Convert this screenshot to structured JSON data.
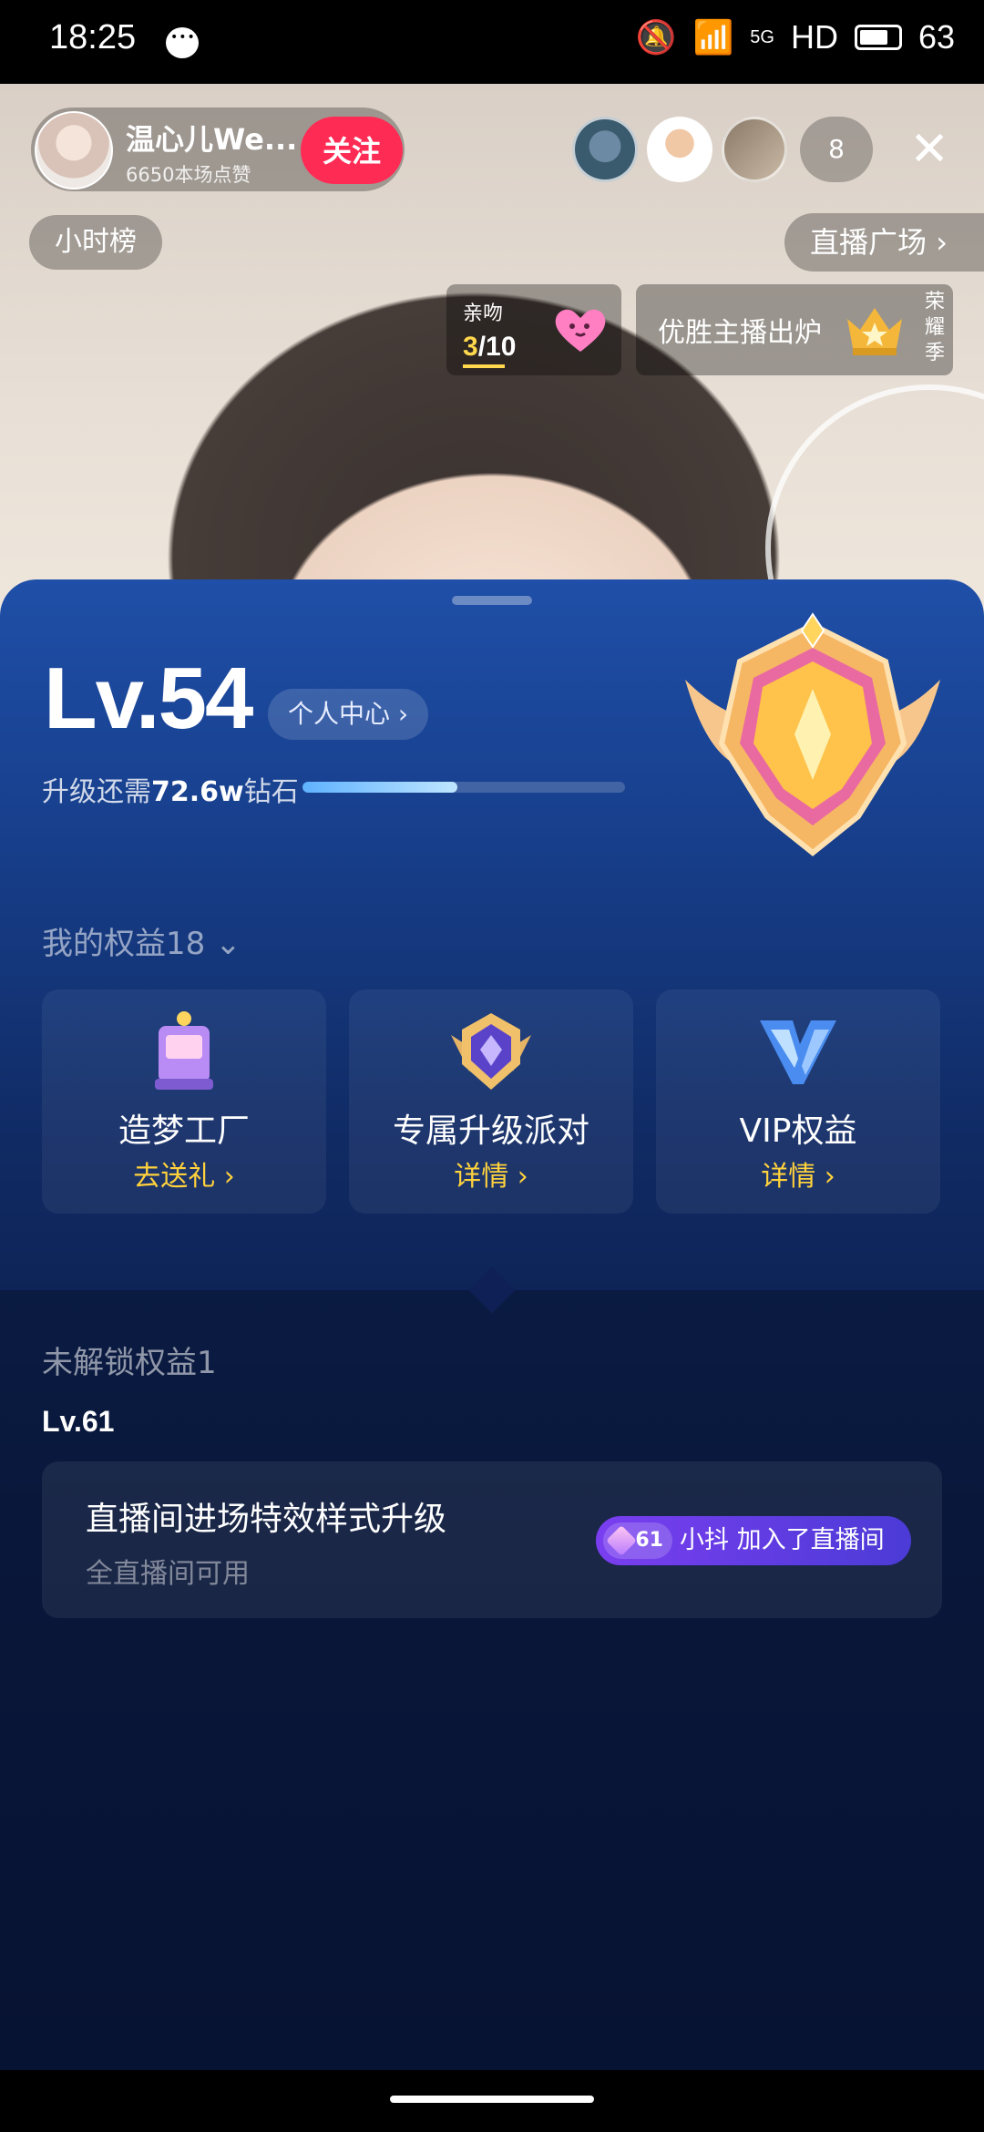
{
  "status_bar": {
    "time": "18:25",
    "net": "5G",
    "hd": "HD",
    "battery": "63"
  },
  "host": {
    "name": "温心儿We...",
    "likes": "6650本场点赞",
    "follow_label": "关注"
  },
  "viewers": {
    "count": "8"
  },
  "hour_rank": "小时榜",
  "live_square": "直播广场",
  "kiss": {
    "label": "亲吻",
    "current": "3",
    "total": "/10"
  },
  "honor": {
    "text": "优胜主播出炉",
    "tag": "荣耀季"
  },
  "level": {
    "title": "Lv.54",
    "center_label": "个人中心",
    "upgrade_prefix": "升级还需",
    "upgrade_amount": "72.6w",
    "upgrade_suffix": "钻石",
    "progress": 0.48
  },
  "rights": {
    "title": "我的权益18",
    "items": [
      {
        "name": "造梦工厂",
        "link": "去送礼"
      },
      {
        "name": "专属升级派对",
        "link": "详情"
      },
      {
        "name": "VIP权益",
        "link": "详情"
      }
    ]
  },
  "locked": {
    "title": "未解锁权益1",
    "level": "Lv.61",
    "item_name": "直播间进场特效样式升级",
    "item_sub": "全直播间可用",
    "preview_badge": "61",
    "preview_text": "小抖 加入了直播间"
  },
  "colors": {
    "follow": "#fe2c55",
    "link_yellow": "#ffd23c",
    "sheet_top": "#1f4fa8",
    "sheet_bottom": "#061233"
  }
}
